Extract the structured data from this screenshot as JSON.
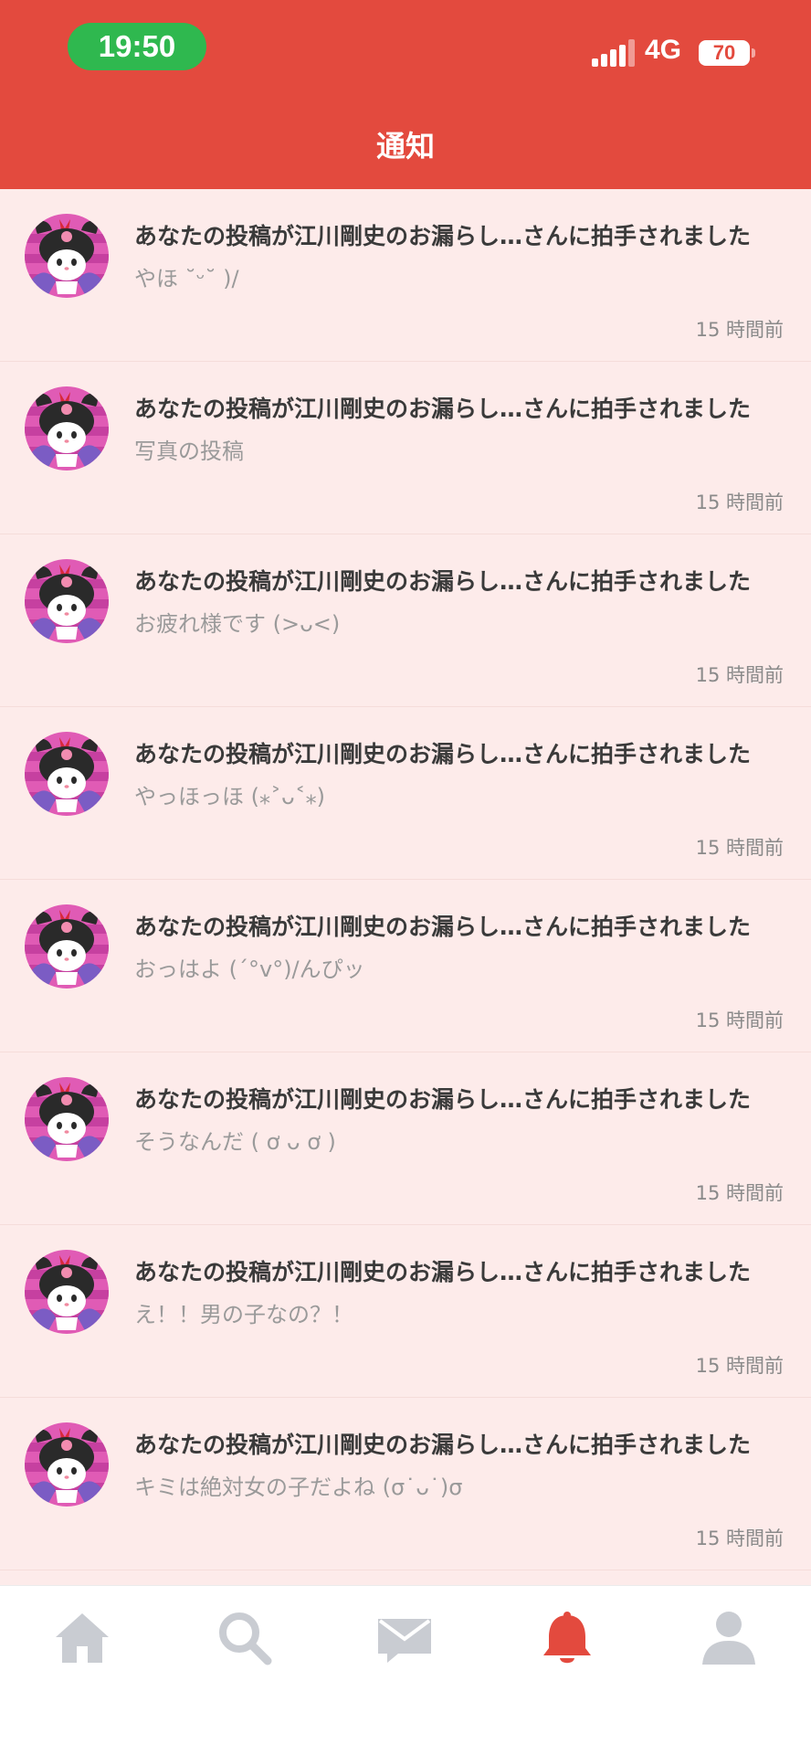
{
  "status_bar": {
    "time": "19:50",
    "network": "4G",
    "battery": "70"
  },
  "header": {
    "title": "通知"
  },
  "notifications": [
    {
      "message": "あなたの投稿が江川剛史のお漏らし…さんに拍手されました",
      "post": "やほ ˘ᵕ˘ )/",
      "time_ago": "15 時間前"
    },
    {
      "message": "あなたの投稿が江川剛史のお漏らし…さんに拍手されました",
      "post": "写真の投稿",
      "time_ago": "15 時間前"
    },
    {
      "message": "あなたの投稿が江川剛史のお漏らし…さんに拍手されました",
      "post": "お疲れ様です (>ᴗ<)",
      "time_ago": "15 時間前"
    },
    {
      "message": "あなたの投稿が江川剛史のお漏らし…さんに拍手されました",
      "post": "やっほっほ (⁎˃ᴗ˂⁎)",
      "time_ago": "15 時間前"
    },
    {
      "message": "あなたの投稿が江川剛史のお漏らし…さんに拍手されました",
      "post": "おっはよ (´°v°)/んぴッ",
      "time_ago": "15 時間前"
    },
    {
      "message": "あなたの投稿が江川剛史のお漏らし…さんに拍手されました",
      "post": "そうなんだ ( ơ ᴗ ơ )",
      "time_ago": "15 時間前"
    },
    {
      "message": "あなたの投稿が江川剛史のお漏らし…さんに拍手されました",
      "post": "え！！男の子なの？！",
      "time_ago": "15 時間前"
    },
    {
      "message": "あなたの投稿が江川剛史のお漏らし…さんに拍手されました",
      "post": "キミは絶対女の子だよね (σ˙ᴗ˙)σ",
      "time_ago": "15 時間前"
    }
  ],
  "tab_bar": {
    "items": [
      {
        "icon": "home-icon",
        "active": false
      },
      {
        "icon": "search-icon",
        "active": false
      },
      {
        "icon": "mail-icon",
        "active": false
      },
      {
        "icon": "bell-icon",
        "active": true
      },
      {
        "icon": "profile-icon",
        "active": false
      }
    ]
  },
  "colors": {
    "header": "#e34a3e",
    "list_background": "#fdebea",
    "active_tab": "#e34a3e",
    "inactive_tab": "#c9ccd2"
  }
}
